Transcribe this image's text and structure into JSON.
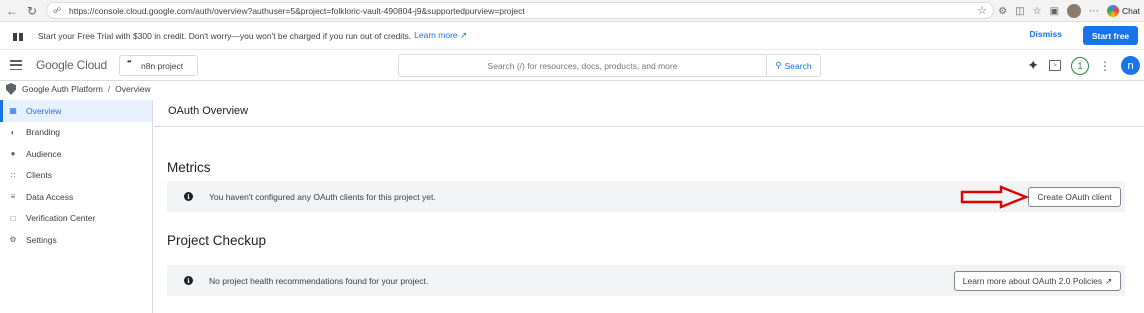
{
  "browser": {
    "url": "https://console.cloud.google.com/auth/overview?authuser=5&project=folkloric-vault-490804-j9&supportedpurview=project",
    "chat_label": "Chat"
  },
  "banner": {
    "text": "Start your Free Trial with $300 in credit. Don't worry—you won't be charged if you run out of credits.",
    "learn_more": "Learn more",
    "dismiss": "Dismiss",
    "start_free": "Start free"
  },
  "header": {
    "logo_google": "Google",
    "logo_cloud": "Cloud",
    "project": "n8n project",
    "search_placeholder": "Search (/) for resources, docs, products, and more",
    "search_button": "Search",
    "notification_count": "1",
    "avatar_letter": "n"
  },
  "breadcrumb": {
    "root": "Google Auth Platform",
    "separator": "/",
    "current": "Overview"
  },
  "sidebar": {
    "items": [
      {
        "label": "Overview",
        "icon": "grid-icon"
      },
      {
        "label": "Branding",
        "icon": "palette-icon"
      },
      {
        "label": "Audience",
        "icon": "person-icon"
      },
      {
        "label": "Clients",
        "icon": "apps-icon"
      },
      {
        "label": "Data Access",
        "icon": "filter-list-icon"
      },
      {
        "label": "Verification Center",
        "icon": "verified-icon"
      },
      {
        "label": "Settings",
        "icon": "gear-icon"
      }
    ]
  },
  "main": {
    "title": "OAuth Overview",
    "metrics": {
      "heading": "Metrics",
      "notice": "You haven't configured any OAuth clients for this project yet.",
      "button": "Create OAuth client"
    },
    "checkup": {
      "heading": "Project Checkup",
      "notice": "No project health recommendations found for your project.",
      "button": "Learn more about OAuth 2.0 Policies"
    }
  },
  "colors": {
    "accent": "#1a73e8",
    "annotation_arrow": "#e00000",
    "notification": "#1e8e3e"
  }
}
